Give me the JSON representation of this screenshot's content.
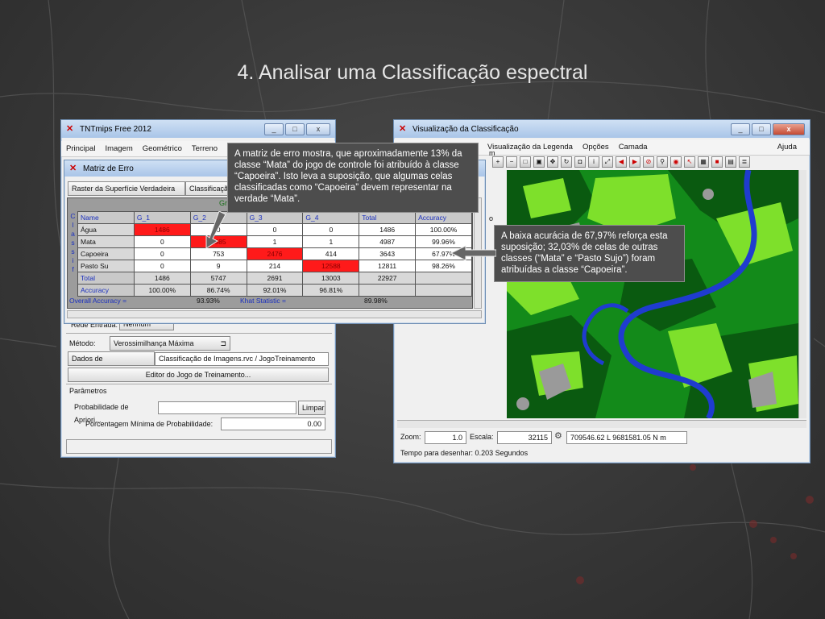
{
  "slide": {
    "title": "4. Analisar uma Classificação espectral"
  },
  "tnt": {
    "title": "TNTmips Free 2012",
    "menu": [
      "Principal",
      "Imagem",
      "Geométrico",
      "Terreno"
    ],
    "rede_entrada_label": "Rede Entrada:",
    "rede_entrada_value": "Nenhum",
    "metodo_label": "Método:",
    "metodo_value": "Verossimilhança Máxima",
    "dados_btn": "Dados de Treinamento...",
    "dados_value": "Classificação de Imagens.rvc / JogoTreinamento",
    "editor_btn": "Editor do Jogo de Treinamento...",
    "parametros_label": "Parâmetros",
    "prob_btn": "Probabilidade de Apriori...",
    "limpar_btn": "Limpar",
    "porcent_label": "Porcentagem Mínima de Probabilidade:",
    "porcent_value": "0.00"
  },
  "matriz": {
    "title": "Matriz de Erro",
    "raster_btn": "Raster da Superfície Verdadeira ...",
    "class_btn": "Classificação ...",
    "ground_label": "Gr",
    "side_label": [
      "C",
      "l",
      "a",
      "s",
      "s",
      "i",
      "f"
    ],
    "headers": [
      "Name",
      "G_1",
      "G_2",
      "G_3",
      "G_4",
      "Total",
      "Accuracy"
    ],
    "rows": [
      [
        "Água",
        "1486",
        "0",
        "0",
        "0",
        "1486",
        "100.00%"
      ],
      [
        "Mata",
        "0",
        "4985",
        "1",
        "1",
        "4987",
        "99.96%"
      ],
      [
        "Capoeira",
        "0",
        "753",
        "2476",
        "414",
        "3643",
        "67.97%"
      ],
      [
        "Pasto Su",
        "0",
        "9",
        "214",
        "12588",
        "12811",
        "98.26%"
      ]
    ],
    "total_row": [
      "Total",
      "1486",
      "5747",
      "2691",
      "13003",
      "22927"
    ],
    "accuracy_row": [
      "Accuracy",
      "100.00%",
      "86.74%",
      "92.01%",
      "96.81%"
    ],
    "overall_label": "Overall Accuracy =",
    "overall_value": "93.93%",
    "khat_label": "Khat Statistic =",
    "khat_value": "89.98%"
  },
  "viz": {
    "title": "Visualização da Classificação",
    "menu_partial": "ta",
    "menu": [
      "Visualização da Legenda",
      "Opções",
      "Camada"
    ],
    "help": "Ajuda",
    "side_partial_1": "m",
    "side_partial_2": "o",
    "zoom_label": "Zoom:",
    "zoom_value": "1.0",
    "escala_label": "Escala:",
    "escala_value": "32115",
    "coords": "709546.62 L  9681581.05 N m",
    "status": "Tempo para desenhar: 0.203 Segundos"
  },
  "callouts": {
    "top": "A matriz de erro mostra, que aproximadamente 13% da classe “Mata” do jogo de controle foi atribuído à classe “Capoeira”. Isto leva a suposição, que algumas celas classificadas como “Capoeira” devem representar na verdade “Mata”.",
    "right": "A baixa acurácia de 67,97% reforça esta suposição; 32,03% de celas de outras classes (“Mata” e “Pasto Sujo”) foram atribuídas a classe “Capoeira”."
  },
  "colors": {
    "accent_red": "#ff1a1a",
    "river": "#1f3ccf",
    "dark_green": "#0b5a12",
    "light_green": "#7be02a"
  }
}
